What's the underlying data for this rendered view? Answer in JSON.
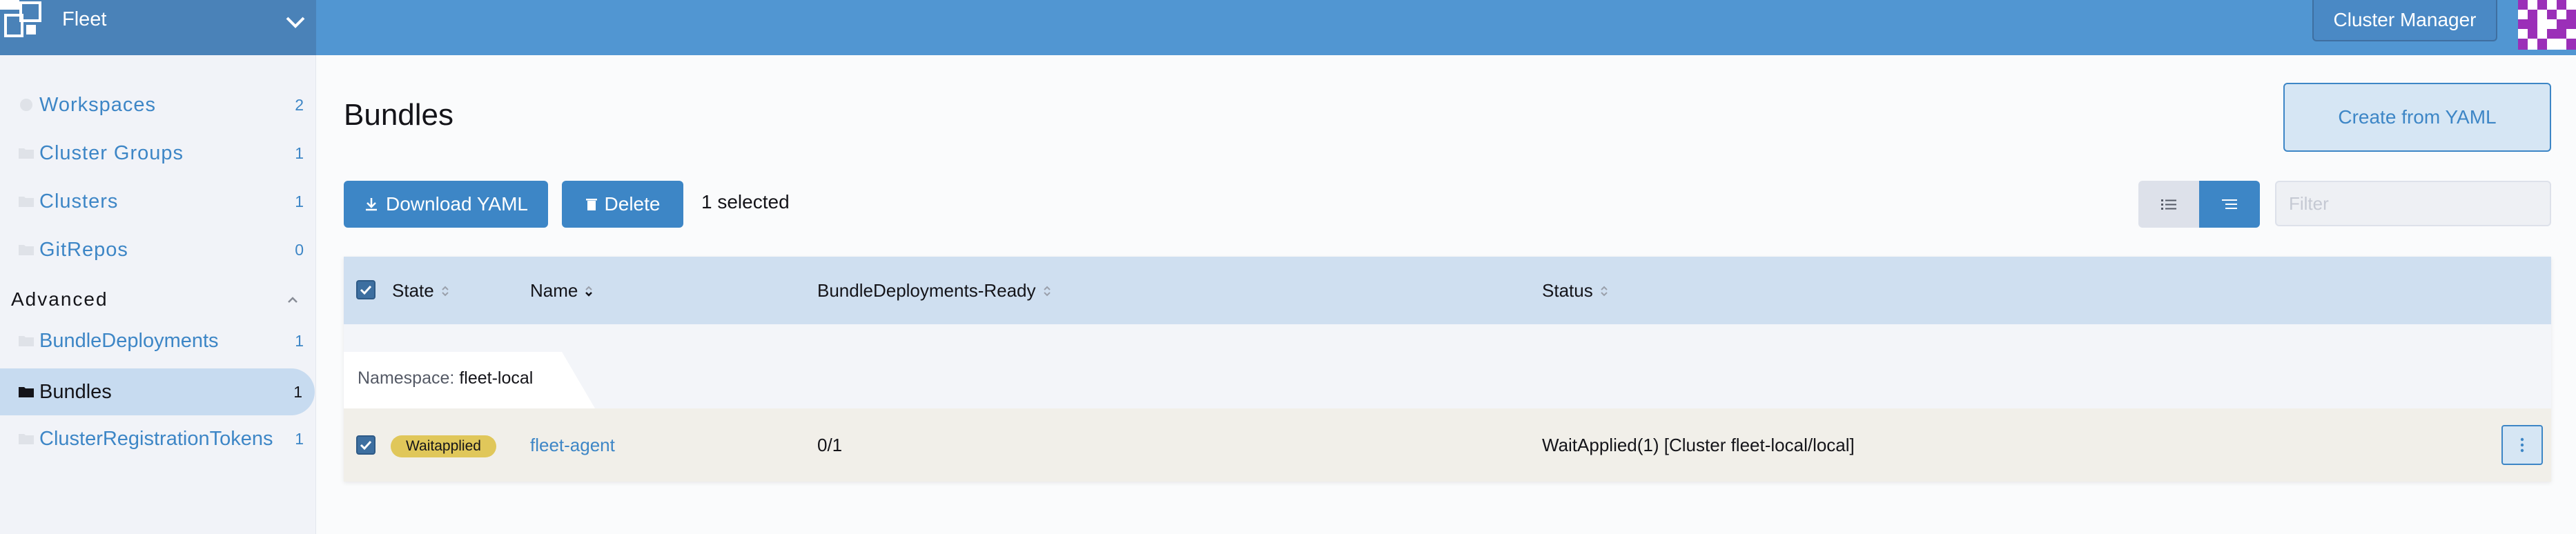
{
  "header": {
    "app_title": "Fleet",
    "cluster_button": "Cluster Manager"
  },
  "sidebar": {
    "items": [
      {
        "label": "Workspaces",
        "count": "2",
        "icon": "circle-icon"
      },
      {
        "label": "Cluster Groups",
        "count": "1",
        "icon": "folder-icon"
      },
      {
        "label": "Clusters",
        "count": "1",
        "icon": "folder-icon"
      },
      {
        "label": "GitRepos",
        "count": "0",
        "icon": "folder-icon"
      }
    ],
    "group_label": "Advanced",
    "advanced_items": [
      {
        "label": "BundleDeployments",
        "count": "1",
        "icon": "folder-icon"
      },
      {
        "label": "Bundles",
        "count": "1",
        "icon": "folder-icon",
        "active": true
      },
      {
        "label": "ClusterRegistrationTokens",
        "count": "1",
        "icon": "folder-icon"
      }
    ]
  },
  "main": {
    "title": "Bundles",
    "create_button": "Create from YAML",
    "download_button": "Download YAML",
    "delete_button": "Delete",
    "selected_count": "1 selected",
    "filter_placeholder": "Filter"
  },
  "table": {
    "columns": [
      "State",
      "Name",
      "BundleDeployments-Ready",
      "Status"
    ],
    "group": {
      "label": "Namespace:",
      "value": "fleet-local"
    },
    "rows": [
      {
        "state": "Waitapplied",
        "name": "fleet-agent",
        "ready": "0/1",
        "status": "WaitApplied(1) [Cluster fleet-local/local]"
      }
    ]
  },
  "colors": {
    "header": "#5196d2",
    "accent": "#3d86c6",
    "state_badge": "#e0c75a"
  }
}
